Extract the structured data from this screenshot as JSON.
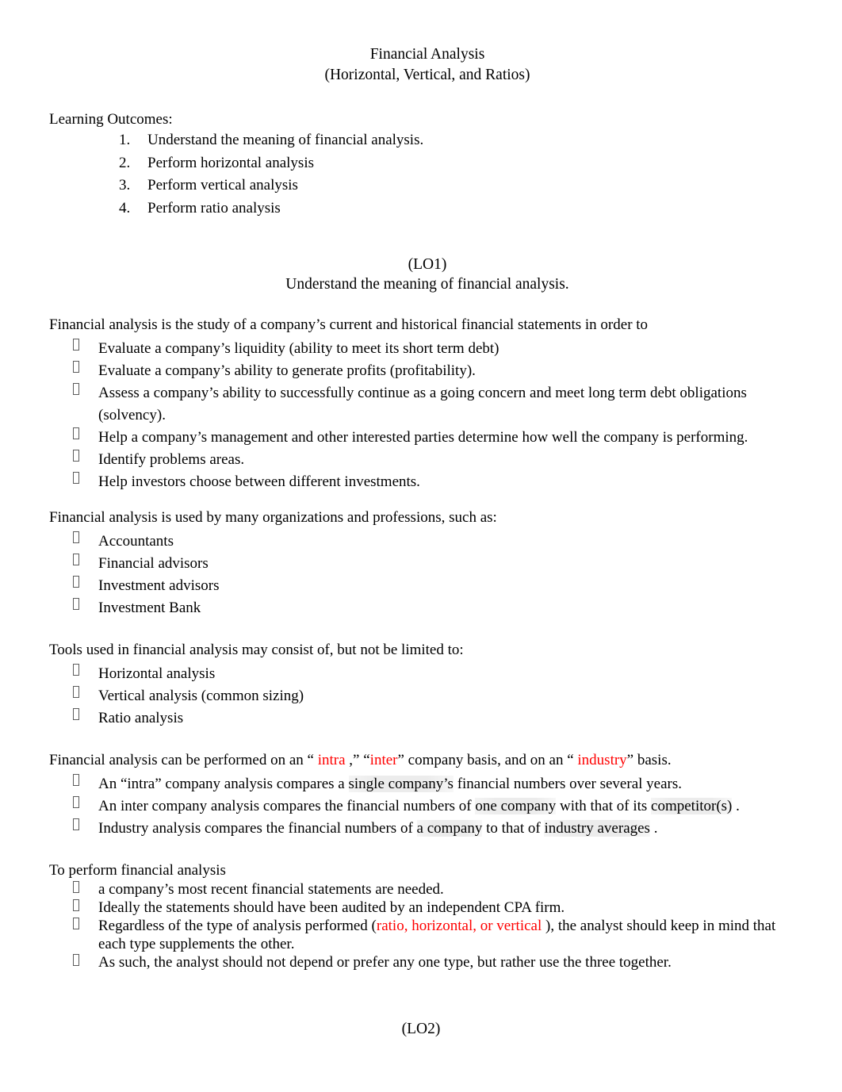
{
  "document": {
    "title_line1": "Financial Analysis",
    "title_line2": "(Horizontal, Vertical, and Ratios)",
    "footer_label": "(LO2)"
  },
  "learning_outcomes": {
    "heading": "Learning Outcomes:",
    "items": [
      {
        "num": "1.",
        "text": "Understand the meaning of financial analysis."
      },
      {
        "num": "2.",
        "text": "Perform horizontal analysis"
      },
      {
        "num": "3.",
        "text": "Perform vertical analysis"
      },
      {
        "num": "4.",
        "text": "Perform ratio analysis"
      }
    ]
  },
  "lo1": {
    "label": "(LO1)",
    "subtitle": "Understand the meaning of financial analysis."
  },
  "definition": {
    "lead": "Financial analysis is the study of a company’s current and historical financial statements in order to",
    "bullets": [
      "Evaluate a company’s liquidity (ability to meet its short term debt)",
      "Evaluate a company’s ability to generate profits (profitability).",
      "Assess a company’s ability to successfully continue as a going concern and meet long term debt obligations (solvency).",
      "Help a company’s management and other interested parties determine how well the company is performing.",
      "Identify problems areas.",
      "Help investors choose between different investments."
    ]
  },
  "users": {
    "lead": "Financial analysis is used by many organizations and professions, such as:",
    "bullets": [
      "Accountants",
      "Financial advisors",
      "Investment advisors",
      "Investment Bank"
    ]
  },
  "tools": {
    "lead": "Tools used in financial analysis may consist of, but not be limited to:",
    "bullets": [
      "Horizontal analysis",
      "Vertical analysis (common sizing)",
      "Ratio analysis"
    ]
  },
  "basis": {
    "lead_part1": "Financial analysis can be performed on an “ ",
    "lead_red1": "intra",
    "lead_part2": " ,” “",
    "lead_red2": "inter",
    "lead_part3": "” company basis, and on an “ ",
    "lead_red3": "industry",
    "lead_part4": "” basis.",
    "bullet1_part1": "An “intra” company analysis compares a ",
    "bullet1_shaded": "single company’s",
    "bullet1_part2": " financial numbers over several years.",
    "bullet2_part1": "An inter company analysis compares the financial numbers of ",
    "bullet2_shaded1": "one company",
    "bullet2_part2": " with that of its ",
    "bullet2_shaded2": "competitor(s)",
    "bullet2_part3": " .",
    "bullet3_part1": "Industry analysis compares the financial numbers of ",
    "bullet3_shaded1": "a company",
    "bullet3_part2": " to that of ",
    "bullet3_shaded2": "industry averages",
    "bullet3_part3": " ."
  },
  "perform": {
    "lead": "To perform financial analysis",
    "bullet1": "a company’s most recent financial statements are needed.",
    "bullet2": "Ideally the statements should have been audited by an independent CPA firm.",
    "bullet3_part1": "Regardless of the type of analysis performed (",
    "bullet3_red": "ratio, horizontal, or vertical",
    "bullet3_part2": " ), the analyst should keep in mind that each type supplements the other.",
    "bullet4": "As such, the analyst should not depend or prefer any one type, but rather use the three together."
  }
}
